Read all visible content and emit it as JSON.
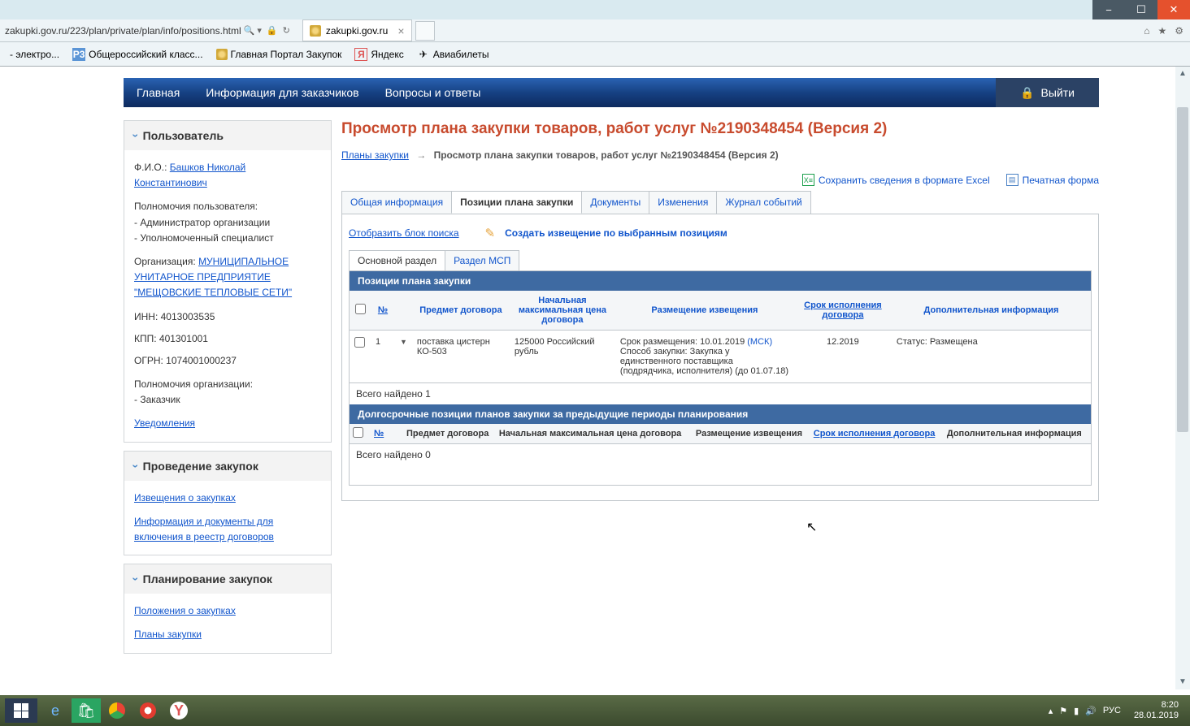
{
  "os": {
    "min": "−",
    "max": "☐",
    "close": "✕"
  },
  "addr": {
    "url": "zakupki.gov.ru/223/plan/private/plan/info/positions.html",
    "tab_title": "zakupki.gov.ru"
  },
  "bookmarks": {
    "b1": "- электро...",
    "b2": "Общероссийский класс...",
    "b3": "Главная Портал Закупок",
    "b4": "Яндекс",
    "b5": "Авиабилеты"
  },
  "nav": {
    "home": "Главная",
    "info": "Информация для заказчиков",
    "faq": "Вопросы и ответы",
    "logout": "Выйти"
  },
  "sidebar": {
    "user": {
      "header": "Пользователь",
      "fio_label": "Ф.И.О.:",
      "fio_value": "Башков Николай Константинович",
      "perm_user_label": "Полномочия пользователя:",
      "perm_user_1": "- Администратор организации",
      "perm_user_2": "- Уполномоченный специалист",
      "org_label": "Организация:",
      "org_value": "МУНИЦИПАЛЬНОЕ УНИТАРНОЕ ПРЕДПРИЯТИЕ \"МЕЩОВСКИЕ ТЕПЛОВЫЕ СЕТИ\"",
      "inn": "ИНН: 4013003535",
      "kpp": "КПП: 401301001",
      "ogrn": "ОГРН: 1074001000237",
      "perm_org_label": "Полномочия организации:",
      "perm_org_1": "- Заказчик",
      "notif": "Уведомления"
    },
    "purchase": {
      "header": "Проведение закупок",
      "l1": "Извещения о закупках",
      "l2": "Информация и документы для включения в реестр договоров"
    },
    "planning": {
      "header": "Планирование закупок",
      "l1": "Положения о закупках",
      "l2": "Планы закупки"
    }
  },
  "content": {
    "title": "Просмотр плана закупки товаров, работ услуг №2190348454 (Версия 2)",
    "breadcrumb_root": "Планы закупки",
    "breadcrumb_current": "Просмотр плана закупки товаров, работ услуг №2190348454 (Версия 2)",
    "save_excel": "Сохранить сведения в формате Excel",
    "print_form": "Печатная форма",
    "tabs1": {
      "t1": "Общая информация",
      "t2": "Позиции плана закупки",
      "t3": "Документы",
      "t4": "Изменения",
      "t5": "Журнал событий"
    },
    "show_search": "Отобразить блок поиска",
    "create_notice": "Создать извещение по выбранным позициям",
    "tabs2": {
      "t1": "Основной раздел",
      "t2": "Раздел МСП"
    },
    "group1_header": "Позиции плана закупки",
    "headers": {
      "num": "№",
      "subject": "Предмет договора",
      "price": "Начальная максимальная цена договора",
      "placement": "Размещение извещения",
      "term": "Срок исполнения договора",
      "extra": "Дополнительная информация"
    },
    "row1": {
      "num": "1",
      "subject": "поставка цистерн КО-503",
      "price": "125000 Российский рубль",
      "place_date_lbl": "Срок размещения: ",
      "place_date": "10.01.2019 ",
      "msk": "(МСК)",
      "method_lbl": "Способ закупки: ",
      "method": "Закупка у единственного поставщика (подрядчика, исполнителя) (до 01.07.18)",
      "term": "12.2019",
      "status_lbl": "Статус: ",
      "status": "Размещена"
    },
    "found1": "Всего найдено 1",
    "group2_header": "Долгосрочные позиции планов закупки за предыдущие периоды планирования",
    "found2": "Всего найдено 0"
  },
  "taskbar": {
    "lang": "РУС",
    "time": "8:20",
    "date": "28.01.2019"
  }
}
